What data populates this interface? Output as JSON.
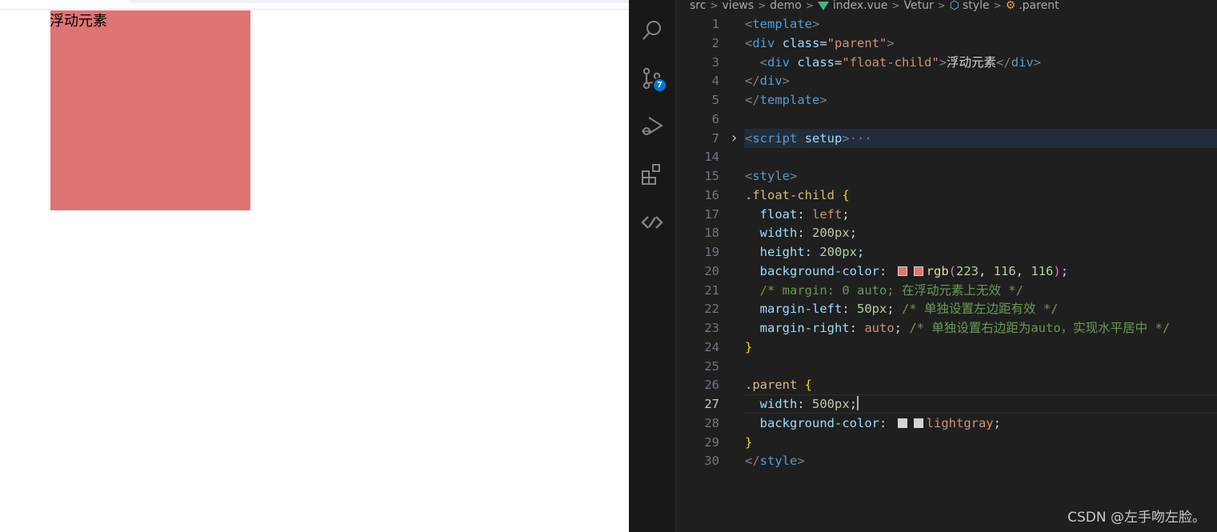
{
  "browser": {
    "float_child_text": "浮动元素",
    "float_child_color": "#df7474"
  },
  "breadcrumb": [
    "src",
    "views",
    "demo",
    "index.vue",
    "Vetur",
    "style",
    ".parent"
  ],
  "activity_bar": {
    "icons": [
      "search-icon",
      "source-control-icon",
      "run-debug-icon",
      "extensions-icon",
      "remote-icon"
    ],
    "source_control_badge": "7"
  },
  "editor": {
    "lines": [
      {
        "n": "1",
        "tokens": [
          [
            "t-brk",
            "<"
          ],
          [
            "t-tag",
            "template"
          ],
          [
            "t-brk",
            ">"
          ]
        ]
      },
      {
        "n": "2",
        "tokens": [
          [
            "t-brk",
            "<"
          ],
          [
            "t-tag",
            "div"
          ],
          [
            "t-txt",
            " "
          ],
          [
            "t-attr",
            "class"
          ],
          [
            "t-txt",
            "="
          ],
          [
            "t-str",
            "\"parent\""
          ],
          [
            "t-brk",
            ">"
          ]
        ]
      },
      {
        "n": "3",
        "tokens": [
          [
            "t-txt",
            "  "
          ],
          [
            "t-brk",
            "<"
          ],
          [
            "t-tag",
            "div"
          ],
          [
            "t-txt",
            " "
          ],
          [
            "t-attr",
            "class"
          ],
          [
            "t-txt",
            "="
          ],
          [
            "t-str",
            "\"float-child\""
          ],
          [
            "t-brk",
            ">"
          ],
          [
            "t-txt",
            "浮动元素"
          ],
          [
            "t-brk",
            "</"
          ],
          [
            "t-tag",
            "div"
          ],
          [
            "t-brk",
            ">"
          ]
        ]
      },
      {
        "n": "4",
        "tokens": [
          [
            "t-brk",
            "</"
          ],
          [
            "t-tag",
            "div"
          ],
          [
            "t-brk",
            ">"
          ]
        ]
      },
      {
        "n": "5",
        "tokens": [
          [
            "t-brk",
            "</"
          ],
          [
            "t-tag",
            "template"
          ],
          [
            "t-brk",
            ">"
          ]
        ]
      },
      {
        "n": "6",
        "tokens": []
      },
      {
        "n": "7",
        "tokens": [
          [
            "t-brk",
            "<"
          ],
          [
            "t-tag",
            "script"
          ],
          [
            "t-txt",
            " "
          ],
          [
            "t-attr",
            "setup"
          ],
          [
            "t-brk",
            ">"
          ],
          [
            "t-brk",
            "···"
          ]
        ],
        "fold": true,
        "highlight": true
      },
      {
        "n": "14",
        "tokens": []
      },
      {
        "n": "15",
        "tokens": [
          [
            "t-brk",
            "<"
          ],
          [
            "t-tag",
            "style"
          ],
          [
            "t-brk",
            ">"
          ]
        ]
      },
      {
        "n": "16",
        "tokens": [
          [
            "t-sel",
            ".float-child"
          ],
          [
            "t-txt",
            " "
          ],
          [
            "t-br1",
            "{"
          ]
        ]
      },
      {
        "n": "17",
        "tokens": [
          [
            "t-txt",
            "  "
          ],
          [
            "t-prop",
            "float"
          ],
          [
            "t-txt",
            ": "
          ],
          [
            "t-val",
            "left"
          ],
          [
            "t-txt",
            ";"
          ]
        ]
      },
      {
        "n": "18",
        "tokens": [
          [
            "t-txt",
            "  "
          ],
          [
            "t-prop",
            "width"
          ],
          [
            "t-txt",
            ": "
          ],
          [
            "t-num",
            "200px"
          ],
          [
            "t-txt",
            ";"
          ]
        ]
      },
      {
        "n": "19",
        "tokens": [
          [
            "t-txt",
            "  "
          ],
          [
            "t-prop",
            "height"
          ],
          [
            "t-txt",
            ": "
          ],
          [
            "t-num",
            "200px"
          ],
          [
            "t-txt",
            ";"
          ]
        ]
      },
      {
        "n": "20",
        "tokens": [
          [
            "t-txt",
            "  "
          ],
          [
            "t-prop",
            "background-color"
          ],
          [
            "t-txt",
            ": "
          ],
          [
            "swatch",
            "#df7474"
          ],
          [
            "t-fn",
            "rgb"
          ],
          [
            "t-br2",
            "("
          ],
          [
            "t-num",
            "223"
          ],
          [
            "t-txt",
            ", "
          ],
          [
            "t-num",
            "116"
          ],
          [
            "t-txt",
            ", "
          ],
          [
            "t-num",
            "116"
          ],
          [
            "t-br2",
            ")"
          ],
          [
            "t-txt",
            ";"
          ]
        ]
      },
      {
        "n": "21",
        "tokens": [
          [
            "t-txt",
            "  "
          ],
          [
            "t-cmt",
            "/* margin: 0 auto; 在浮动元素上无效 */"
          ]
        ]
      },
      {
        "n": "22",
        "tokens": [
          [
            "t-txt",
            "  "
          ],
          [
            "t-prop",
            "margin-left"
          ],
          [
            "t-txt",
            ": "
          ],
          [
            "t-num",
            "50px"
          ],
          [
            "t-txt",
            "; "
          ],
          [
            "t-cmt",
            "/* 单独设置左边距有效 */"
          ]
        ]
      },
      {
        "n": "23",
        "tokens": [
          [
            "t-txt",
            "  "
          ],
          [
            "t-prop",
            "margin-right"
          ],
          [
            "t-txt",
            ": "
          ],
          [
            "t-val",
            "auto"
          ],
          [
            "t-txt",
            "; "
          ],
          [
            "t-cmt",
            "/* 单独设置右边距为auto，实现水平居中 */"
          ]
        ]
      },
      {
        "n": "24",
        "tokens": [
          [
            "t-br1",
            "}"
          ]
        ]
      },
      {
        "n": "25",
        "tokens": []
      },
      {
        "n": "26",
        "tokens": [
          [
            "t-sel",
            ".parent"
          ],
          [
            "t-txt",
            " "
          ],
          [
            "t-br1",
            "{"
          ]
        ]
      },
      {
        "n": "27",
        "tokens": [
          [
            "t-txt",
            "  "
          ],
          [
            "t-prop",
            "width"
          ],
          [
            "t-txt",
            ": "
          ],
          [
            "t-num",
            "500px"
          ],
          [
            "t-txt",
            ";"
          ],
          [
            "cursor",
            ""
          ]
        ],
        "current": true
      },
      {
        "n": "28",
        "tokens": [
          [
            "t-txt",
            "  "
          ],
          [
            "t-prop",
            "background-color"
          ],
          [
            "t-txt",
            ": "
          ],
          [
            "swatch",
            "#d3d3d3"
          ],
          [
            "t-val",
            "lightgray"
          ],
          [
            "t-txt",
            ";"
          ]
        ]
      },
      {
        "n": "29",
        "tokens": [
          [
            "t-br1",
            "}"
          ]
        ]
      },
      {
        "n": "30",
        "tokens": [
          [
            "t-brk",
            "</"
          ],
          [
            "t-tag",
            "style"
          ],
          [
            "t-brk",
            ">"
          ]
        ]
      }
    ]
  },
  "watermark": "CSDN @左手吻左脸。"
}
